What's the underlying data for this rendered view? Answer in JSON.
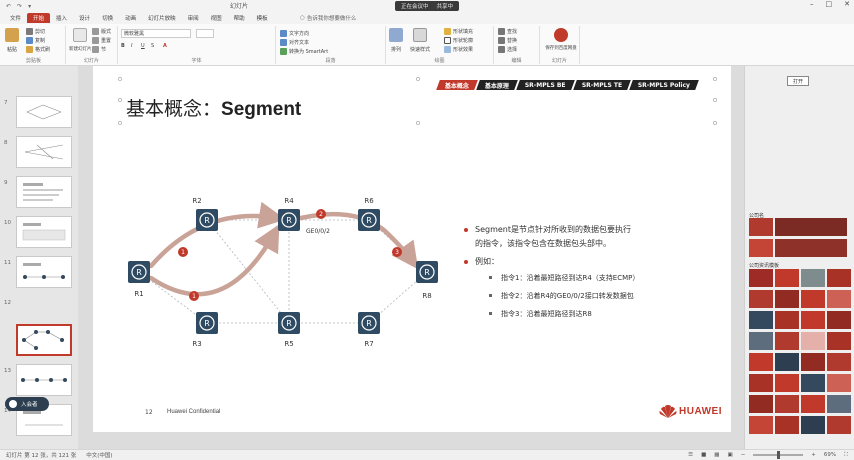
{
  "titlebar": {
    "quick_access": [
      "↶",
      "↷",
      "▾"
    ],
    "doc_title": "幻灯片",
    "center_pill": [
      "正在会议中",
      "共享中"
    ],
    "win_buttons": [
      "–",
      "□",
      "✕"
    ]
  },
  "tabs": [
    "文件",
    "开始",
    "插入",
    "设计",
    "切换",
    "动画",
    "幻灯片放映",
    "审阅",
    "视图",
    "帮助",
    "模板"
  ],
  "active_tab": "开始",
  "search_placeholder": "告诉我你想要做什么",
  "ribbon": {
    "groups": [
      {
        "label": "剪贴板",
        "buttons": [
          "粘贴",
          "剪切",
          "复制",
          "格式刷"
        ]
      },
      {
        "label": "幻灯片",
        "buttons": [
          "新建幻灯片",
          "版式",
          "重置",
          "节"
        ]
      },
      {
        "label": "字体",
        "buttons": [
          "微软雅黑",
          "B",
          "I",
          "U",
          "S",
          "A"
        ]
      },
      {
        "label": "段落",
        "buttons": [
          "文字方向",
          "对齐文本",
          "转换为 SmartArt"
        ]
      },
      {
        "label": "绘图",
        "buttons": [
          "排列",
          "快速样式",
          "形状填充",
          "形状轮廓",
          "形状效果"
        ]
      },
      {
        "label": "编辑",
        "buttons": [
          "查找",
          "替换",
          "选择"
        ]
      },
      {
        "label": "幻灯片",
        "buttons": [
          "保存到百度网盘"
        ]
      }
    ]
  },
  "thumbnails": [
    {
      "num": "7"
    },
    {
      "num": "8"
    },
    {
      "num": "9"
    },
    {
      "num": "10"
    },
    {
      "num": "11"
    },
    {
      "num": "12",
      "selected": true
    },
    {
      "num": "13"
    },
    {
      "num": "14"
    }
  ],
  "slide": {
    "nav_tags": [
      "基本概念",
      "基本原理",
      "SR-MPLS BE",
      "SR-MPLS TE",
      "SR-MPLS Policy"
    ],
    "title_cn": "基本概念：",
    "title_en": "Segment",
    "routers": [
      "R1",
      "R2",
      "R3",
      "R4",
      "R5",
      "R6",
      "R7",
      "R8"
    ],
    "interface_label": "GE0/0/2",
    "step_labels": [
      "1",
      "1",
      "2",
      "3"
    ],
    "bullet1": "Segment是节点针对所收到的数据包要执行的指令，该指令包含在数据包头部中。",
    "bullet1_line1": "Segment是节点针对所收到的数据包要执行",
    "bullet1_line2": "的指令，该指令包含在数据包头部中。",
    "bullet2": "例如：",
    "sub_bullets": [
      "指令1：沿着最短路径到达R4（支持ECMP）",
      "指令2：沿着R4的GE0/0/2接口转发数据包",
      "指令3：沿着最短路径到达R8"
    ],
    "page_number": "12",
    "footer": "Huawei Confidential",
    "logo": "HUAWEI"
  },
  "right_panel": {
    "open_button": "打开",
    "section1": "公司名",
    "section2": "公司资讯模板"
  },
  "user_chip": "入会者",
  "status": {
    "slide_info": "幻灯片 第 12 张，共 121 张",
    "language": "中文(中国)",
    "zoom": "69%"
  },
  "colors": {
    "accent": "#c0392b",
    "router": "#34495e",
    "path_arrow": "#c9a397"
  }
}
